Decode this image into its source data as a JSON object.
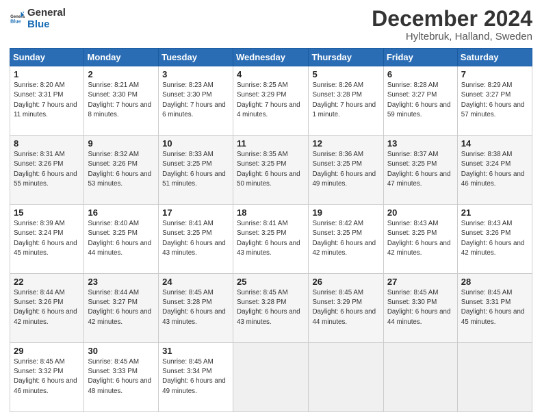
{
  "header": {
    "logo_general": "General",
    "logo_blue": "Blue",
    "month_title": "December 2024",
    "location": "Hyltebruk, Halland, Sweden"
  },
  "calendar": {
    "days_of_week": [
      "Sunday",
      "Monday",
      "Tuesday",
      "Wednesday",
      "Thursday",
      "Friday",
      "Saturday"
    ],
    "weeks": [
      [
        {
          "day": "1",
          "sunrise": "8:20 AM",
          "sunset": "3:31 PM",
          "daylight": "7 hours and 11 minutes."
        },
        {
          "day": "2",
          "sunrise": "8:21 AM",
          "sunset": "3:30 PM",
          "daylight": "7 hours and 8 minutes."
        },
        {
          "day": "3",
          "sunrise": "8:23 AM",
          "sunset": "3:30 PM",
          "daylight": "7 hours and 6 minutes."
        },
        {
          "day": "4",
          "sunrise": "8:25 AM",
          "sunset": "3:29 PM",
          "daylight": "7 hours and 4 minutes."
        },
        {
          "day": "5",
          "sunrise": "8:26 AM",
          "sunset": "3:28 PM",
          "daylight": "7 hours and 1 minute."
        },
        {
          "day": "6",
          "sunrise": "8:28 AM",
          "sunset": "3:27 PM",
          "daylight": "6 hours and 59 minutes."
        },
        {
          "day": "7",
          "sunrise": "8:29 AM",
          "sunset": "3:27 PM",
          "daylight": "6 hours and 57 minutes."
        }
      ],
      [
        {
          "day": "8",
          "sunrise": "8:31 AM",
          "sunset": "3:26 PM",
          "daylight": "6 hours and 55 minutes."
        },
        {
          "day": "9",
          "sunrise": "8:32 AM",
          "sunset": "3:26 PM",
          "daylight": "6 hours and 53 minutes."
        },
        {
          "day": "10",
          "sunrise": "8:33 AM",
          "sunset": "3:25 PM",
          "daylight": "6 hours and 51 minutes."
        },
        {
          "day": "11",
          "sunrise": "8:35 AM",
          "sunset": "3:25 PM",
          "daylight": "6 hours and 50 minutes."
        },
        {
          "day": "12",
          "sunrise": "8:36 AM",
          "sunset": "3:25 PM",
          "daylight": "6 hours and 49 minutes."
        },
        {
          "day": "13",
          "sunrise": "8:37 AM",
          "sunset": "3:25 PM",
          "daylight": "6 hours and 47 minutes."
        },
        {
          "day": "14",
          "sunrise": "8:38 AM",
          "sunset": "3:24 PM",
          "daylight": "6 hours and 46 minutes."
        }
      ],
      [
        {
          "day": "15",
          "sunrise": "8:39 AM",
          "sunset": "3:24 PM",
          "daylight": "6 hours and 45 minutes."
        },
        {
          "day": "16",
          "sunrise": "8:40 AM",
          "sunset": "3:25 PM",
          "daylight": "6 hours and 44 minutes."
        },
        {
          "day": "17",
          "sunrise": "8:41 AM",
          "sunset": "3:25 PM",
          "daylight": "6 hours and 43 minutes."
        },
        {
          "day": "18",
          "sunrise": "8:41 AM",
          "sunset": "3:25 PM",
          "daylight": "6 hours and 43 minutes."
        },
        {
          "day": "19",
          "sunrise": "8:42 AM",
          "sunset": "3:25 PM",
          "daylight": "6 hours and 42 minutes."
        },
        {
          "day": "20",
          "sunrise": "8:43 AM",
          "sunset": "3:25 PM",
          "daylight": "6 hours and 42 minutes."
        },
        {
          "day": "21",
          "sunrise": "8:43 AM",
          "sunset": "3:26 PM",
          "daylight": "6 hours and 42 minutes."
        }
      ],
      [
        {
          "day": "22",
          "sunrise": "8:44 AM",
          "sunset": "3:26 PM",
          "daylight": "6 hours and 42 minutes."
        },
        {
          "day": "23",
          "sunrise": "8:44 AM",
          "sunset": "3:27 PM",
          "daylight": "6 hours and 42 minutes."
        },
        {
          "day": "24",
          "sunrise": "8:45 AM",
          "sunset": "3:28 PM",
          "daylight": "6 hours and 43 minutes."
        },
        {
          "day": "25",
          "sunrise": "8:45 AM",
          "sunset": "3:28 PM",
          "daylight": "6 hours and 43 minutes."
        },
        {
          "day": "26",
          "sunrise": "8:45 AM",
          "sunset": "3:29 PM",
          "daylight": "6 hours and 44 minutes."
        },
        {
          "day": "27",
          "sunrise": "8:45 AM",
          "sunset": "3:30 PM",
          "daylight": "6 hours and 44 minutes."
        },
        {
          "day": "28",
          "sunrise": "8:45 AM",
          "sunset": "3:31 PM",
          "daylight": "6 hours and 45 minutes."
        }
      ],
      [
        {
          "day": "29",
          "sunrise": "8:45 AM",
          "sunset": "3:32 PM",
          "daylight": "6 hours and 46 minutes."
        },
        {
          "day": "30",
          "sunrise": "8:45 AM",
          "sunset": "3:33 PM",
          "daylight": "6 hours and 48 minutes."
        },
        {
          "day": "31",
          "sunrise": "8:45 AM",
          "sunset": "3:34 PM",
          "daylight": "6 hours and 49 minutes."
        },
        null,
        null,
        null,
        null
      ]
    ]
  }
}
